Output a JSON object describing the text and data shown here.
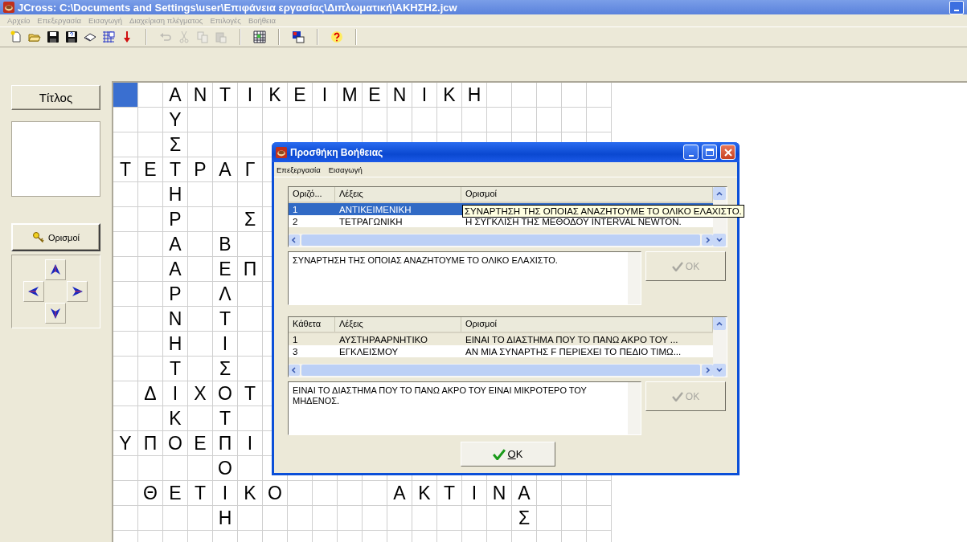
{
  "window": {
    "title": "JCross: C:\\Documents and Settings\\user\\Επιφάνεια εργασίας\\Διπλωματική\\ΑΚΗΣΗ2.jcw"
  },
  "menu": [
    {
      "label": "Αρχείο",
      "disabled": true
    },
    {
      "label": "Επεξεργασία",
      "disabled": true
    },
    {
      "label": "Εισαγωγή",
      "disabled": true
    },
    {
      "label": "Διαχείριση πλέγματος",
      "disabled": true
    },
    {
      "label": "Επιλογές",
      "disabled": true
    },
    {
      "label": "Βοήθεια",
      "disabled": true
    }
  ],
  "toolbar": [
    {
      "kind": "new",
      "disabled": false
    },
    {
      "kind": "open",
      "disabled": false
    },
    {
      "kind": "save",
      "disabled": false
    },
    {
      "kind": "save-as",
      "disabled": false
    },
    {
      "kind": "book",
      "disabled": false
    },
    {
      "kind": "web",
      "disabled": false
    },
    {
      "kind": "down",
      "disabled": false
    },
    {
      "kind": "separator"
    },
    {
      "kind": "undo",
      "disabled": true
    },
    {
      "kind": "cut",
      "disabled": true
    },
    {
      "kind": "copy",
      "disabled": true
    },
    {
      "kind": "paste",
      "disabled": true
    },
    {
      "kind": "separator"
    },
    {
      "kind": "grid",
      "disabled": false
    },
    {
      "kind": "separator"
    },
    {
      "kind": "picture",
      "disabled": false
    },
    {
      "kind": "separator"
    },
    {
      "kind": "help",
      "disabled": false
    },
    {
      "kind": "separator"
    }
  ],
  "side_panel": {
    "title_button": "Τίτλος",
    "definitions_button": "Ορισμοί"
  },
  "grid": {
    "rows": [
      [
        {
          "selected": true
        },
        null,
        "Α",
        "Ν",
        "Τ",
        "Ι",
        "Κ",
        "Ε",
        "Ι",
        "Μ",
        "Ε",
        "Ν",
        "Ι",
        "Κ",
        "Η"
      ],
      [
        null,
        null,
        "Υ"
      ],
      [
        null,
        null,
        "Σ"
      ],
      [
        "Τ",
        "Ε",
        "Τ",
        "Ρ",
        "Α",
        "Γ"
      ],
      [
        null,
        null,
        "Η"
      ],
      [
        null,
        null,
        "Ρ",
        null,
        null,
        "Σ"
      ],
      [
        null,
        null,
        "Α",
        null,
        "Β"
      ],
      [
        null,
        null,
        "Α",
        null,
        "Ε",
        "Π"
      ],
      [
        null,
        null,
        "Ρ",
        null,
        "Λ"
      ],
      [
        null,
        null,
        "Ν",
        null,
        "Τ"
      ],
      [
        null,
        null,
        "Η",
        null,
        "Ι"
      ],
      [
        null,
        null,
        "Τ",
        null,
        "Σ"
      ],
      [
        null,
        "Δ",
        "Ι",
        "Χ",
        "Ο",
        "Τ"
      ],
      [
        null,
        null,
        "Κ",
        null,
        "Τ"
      ],
      [
        "Υ",
        "Π",
        "Ο",
        "Ε",
        "Π",
        "Ι"
      ],
      [
        null,
        null,
        null,
        null,
        "Ο"
      ],
      [
        null,
        "Θ",
        "Ε",
        "Τ",
        "Ι",
        "Κ",
        "Ο",
        null,
        null,
        null,
        null,
        "Α",
        "Κ",
        "Τ",
        "Ι",
        "Ν",
        "Α"
      ],
      [
        null,
        null,
        null,
        null,
        "Η",
        null,
        null,
        null,
        null,
        null,
        null,
        null,
        null,
        null,
        null,
        null,
        "Σ"
      ]
    ]
  },
  "dialog": {
    "title": "Προσθήκη Βοήθειας",
    "menu": [
      "Επεξεργασία",
      "Εισαγωγή"
    ],
    "sections": [
      {
        "focused": true,
        "columns": [
          "Οριζό...",
          "Λέξεις",
          "Ορισμοί"
        ],
        "rows": [
          {
            "number": "1",
            "word": "ΑΝΤΙΚΕΙΜΕΝΙΚΗ",
            "selected": true
          },
          {
            "number": "2",
            "word": "ΤΕΤΡΑΓΩΝΙΚΗ",
            "definition": "Η ΣΥΓΚΛΙΣΗ ΤΗΣ ΜΕΘΟΔΟΥ INTERVAL NEWTON.",
            "selected": false
          }
        ],
        "text": "ΣΥΝΑΡΤΗΣΗ ΤΗΣ ΟΠΟΙΑΣ ΑΝΑΖΗΤΟΥΜΕ ΤΟ ΟΛΙΚΟ ΕΛΑΧΙΣΤΟ.",
        "ok_button": {
          "label": "OK",
          "disabled": true
        }
      },
      {
        "focused": false,
        "columns": [
          "Κάθετα",
          "Λέξεις",
          "Ορισμοί"
        ],
        "rows": [
          {
            "number": "1",
            "word": "ΑΥΣΤΗΡΑΑΡΝΗΤΙΚΟ",
            "definition": "ΕΙΝΑΙ ΤΟ ΔΙΑΣΤΗΜΑ ΠΟΥ ΤΟ ΠΑΝΩ ΑΚΡΟ ΤΟΥ ...",
            "selected": true
          },
          {
            "number": "3",
            "word": "ΕΓΚΛΕΙΣΜΟΥ",
            "definition": "ΑΝ ΜΙΑ ΣΥΝΑΡΤΗΣ F ΠΕΡΙΕΧΕΙ ΤΟ ΠΕΔΙΟ ΤΙΜΩ...",
            "selected": false
          }
        ],
        "text": "ΕΙΝΑΙ ΤΟ ΔΙΑΣΤΗΜΑ ΠΟΥ ΤΟ ΠΑΝΩ ΑΚΡΟ ΤΟΥ ΕΙΝΑΙ ΜΙΚΡΟΤΕΡΟ ΤΟΥ ΜΗΔΕΝΟΣ.",
        "ok_button": {
          "label": "OK",
          "disabled": true
        }
      }
    ],
    "ok_button": "OK",
    "tooltip": "ΣΥΝΑΡΤΗΣΗ ΤΗΣ ΟΠΟΙΑΣ ΑΝΑΖΗΤΟΥΜΕ ΤΟ ΟΛΙΚΟ ΕΛΑΧΙΣΤΟ."
  }
}
